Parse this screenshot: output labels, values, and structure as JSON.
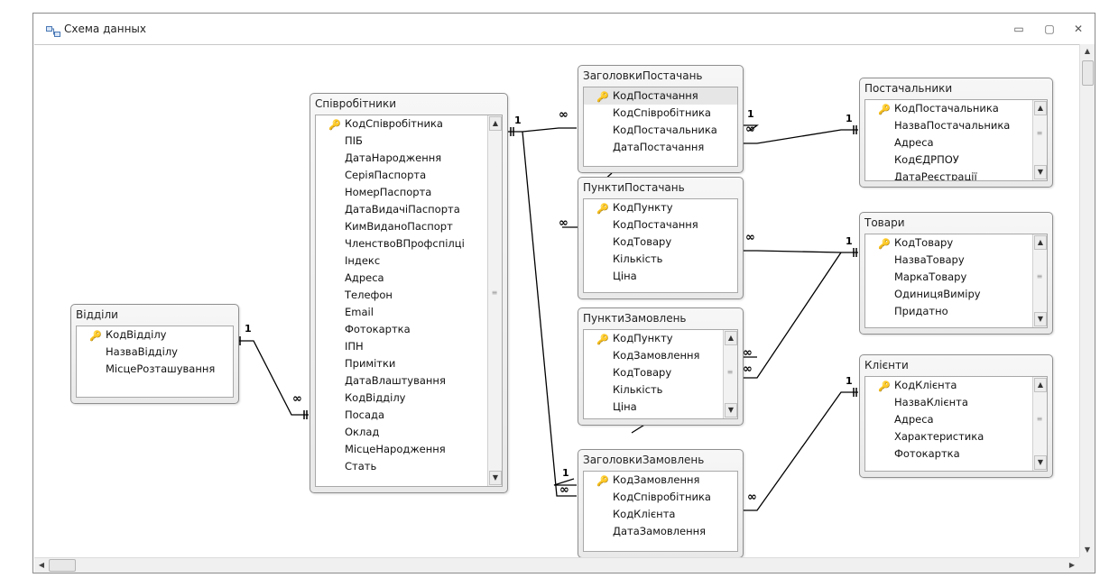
{
  "window": {
    "title": "Схема данных",
    "buttons": {
      "minimize": "▭",
      "restore": "▢",
      "close": "✕"
    }
  },
  "tables": {
    "viddily": {
      "name": "Відділи",
      "fields": [
        "КодВідділу",
        "НазваВідділу",
        "МісцеРозташування"
      ]
    },
    "spivrobitnyky": {
      "name": "Співробітники",
      "fields": [
        "КодСпівробітника",
        "ПІБ",
        "ДатаНародження",
        "СеріяПаспорта",
        "НомерПаспорта",
        "ДатаВидачіПаспорта",
        "КимВиданоПаспорт",
        "ЧленствоВПрофспілці",
        "Індекс",
        "Адреса",
        "Телефон",
        "Email",
        "Фотокартка",
        "ІПН",
        "Примітки",
        "ДатаВлаштування",
        "КодВідділу",
        "Посада",
        "Оклад",
        "МісцеНародження",
        "Стать"
      ]
    },
    "zaholovky_postachan": {
      "name": "ЗаголовкиПостачань",
      "fields": [
        "КодПостачання",
        "КодСпівробітника",
        "КодПостачальника",
        "ДатаПостачання"
      ]
    },
    "punkty_postachan": {
      "name": "ПунктиПостачань",
      "fields": [
        "КодПункту",
        "КодПостачання",
        "КодТовару",
        "Кількість",
        "Ціна"
      ]
    },
    "punkty_zamovlen": {
      "name": "ПунктиЗамовлень",
      "fields": [
        "КодПункту",
        "КодЗамовлення",
        "КодТовару",
        "Кількість",
        "Ціна"
      ]
    },
    "zaholovky_zamovlen": {
      "name": "ЗаголовкиЗамовлень",
      "fields": [
        "КодЗамовлення",
        "КодСпівробітника",
        "КодКлієнта",
        "ДатаЗамовлення"
      ]
    },
    "postachalnyky": {
      "name": "Постачальники",
      "fields": [
        "КодПостачальника",
        "НазваПостачальника",
        "Адреса",
        "КодЄДРПОУ",
        "ДатаРеєстрації"
      ]
    },
    "tovary": {
      "name": "Товари",
      "fields": [
        "КодТовару",
        "НазваТовару",
        "МаркаТовару",
        "ОдиницяВиміру",
        "Придатно"
      ]
    },
    "kliyenty": {
      "name": "Клієнти",
      "fields": [
        "КодКлієнта",
        "НазваКлієнта",
        "Адреса",
        "Характеристика",
        "Фотокартка"
      ]
    }
  },
  "relationship_labels": {
    "one": "1",
    "many": "∞"
  },
  "icons": {
    "app": "relationships-icon",
    "key": "primary-key-icon",
    "scroll_up": "▲",
    "scroll_down": "▼",
    "scroll_left": "◀",
    "scroll_right": "▶",
    "grip": "≡"
  },
  "colors": {
    "window_border": "#8a8a8a",
    "table_header_bg": "#efefef",
    "key_icon": "#c9a21a",
    "selected_row": "#e6e6e6"
  }
}
